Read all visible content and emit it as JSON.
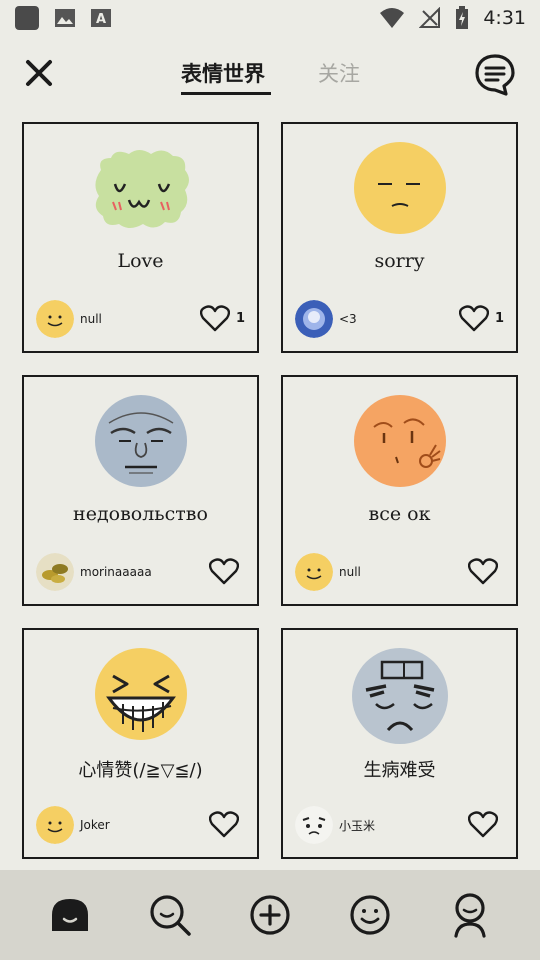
{
  "status": {
    "time": "4:31"
  },
  "header": {
    "tabs": [
      {
        "label": "表情世界",
        "active": true
      },
      {
        "label": "关注",
        "active": false
      }
    ]
  },
  "cards": [
    {
      "title": "Love",
      "author": "null",
      "likes": "1",
      "emoji": "green-uwu-icon"
    },
    {
      "title": "sorry",
      "author": "<3",
      "likes": "1",
      "emoji": "yellow-sorry-icon"
    },
    {
      "title": "недовольство",
      "author": "morinaaaaa",
      "likes": "",
      "emoji": "grumpy-old-face-icon"
    },
    {
      "title": "все ок",
      "author": "null",
      "likes": "",
      "emoji": "orange-ok-icon"
    },
    {
      "title": "心情赞(/≧▽≦/)",
      "author": "Joker",
      "likes": "",
      "emoji": "laughing-face-icon"
    },
    {
      "title": "生病难受",
      "author": "小玉米",
      "likes": "",
      "emoji": "sick-face-icon"
    }
  ],
  "colors": {
    "background": "#ecece6",
    "navbar": "#d6d5cd",
    "accent_yellow": "#f5cf63",
    "card_border": "#1b1b1b"
  },
  "nav": [
    "home-icon",
    "search-icon",
    "add-icon",
    "emoji-icon",
    "profile-icon"
  ]
}
